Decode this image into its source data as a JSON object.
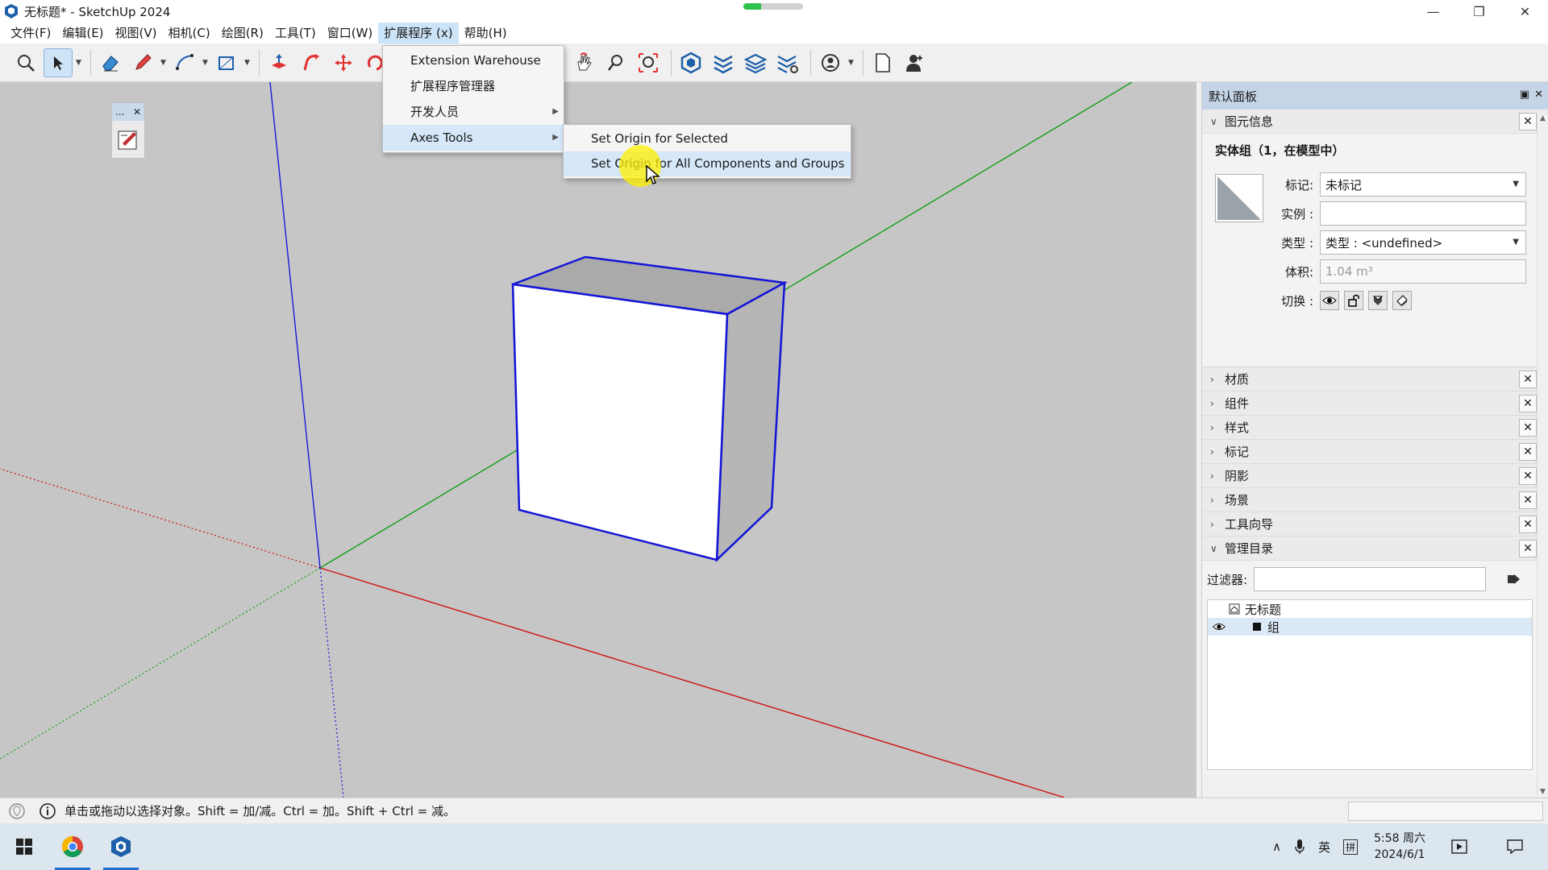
{
  "window": {
    "title": "无标题* - SketchUp 2024",
    "progress": 0.3
  },
  "menu": {
    "items": [
      "文件(F)",
      "编辑(E)",
      "视图(V)",
      "相机(C)",
      "绘图(R)",
      "工具(T)",
      "窗口(W)",
      "扩展程序 (x)",
      "帮助(H)"
    ],
    "active_index": 7
  },
  "extensions_menu": {
    "items": [
      {
        "label": "Extension Warehouse",
        "has_submenu": false
      },
      {
        "label": "扩展程序管理器",
        "has_submenu": false
      },
      {
        "label": "开发人员",
        "has_submenu": true
      },
      {
        "label": "Axes Tools",
        "has_submenu": true
      }
    ],
    "highlighted_index": 3
  },
  "axes_submenu": {
    "items": [
      "Set Origin for Selected",
      "Set Origin for All Components and Groups"
    ],
    "highlighted_index": 1
  },
  "mini_tray": {
    "label": "..."
  },
  "tray": {
    "title": "默认面板",
    "entity_info": {
      "header": "图元信息",
      "title": "实体组（1，在模型中）",
      "tag_label": "标记:",
      "tag_value": "未标记",
      "instance_label": "实例 :",
      "instance_value": "",
      "type_label": "类型 :",
      "type_value": "类型 : <undefined>",
      "volume_label": "体积:",
      "volume_value": "1.04 m³",
      "toggle_label": "切换 :"
    },
    "collapsed_panels": [
      "材质",
      "组件",
      "样式",
      "标记",
      "阴影",
      "场景",
      "工具向导"
    ],
    "outliner": {
      "header": "管理目录",
      "filter_label": "过滤器:",
      "filter_value": "",
      "tree": [
        {
          "label": "无标题",
          "level": 0
        },
        {
          "label": "组",
          "level": 1
        }
      ]
    }
  },
  "status": {
    "text": "单击或拖动以选择对象。Shift = 加/减。Ctrl = 加。Shift + Ctrl = 减。"
  },
  "taskbar": {
    "time": "5:58 周六",
    "date": "2024/6/1",
    "ime_lang": "英",
    "ime_mode": "拼"
  },
  "colors": {
    "viewport_bg": "#c6c6c6",
    "axis_red": "#d01010",
    "axis_green": "#12a012",
    "axis_blue": "#1a1ad8",
    "selection_blue": "#1414d6",
    "menu_highlight": "#d5e7f8",
    "tray_header": "#c5d5e8"
  }
}
